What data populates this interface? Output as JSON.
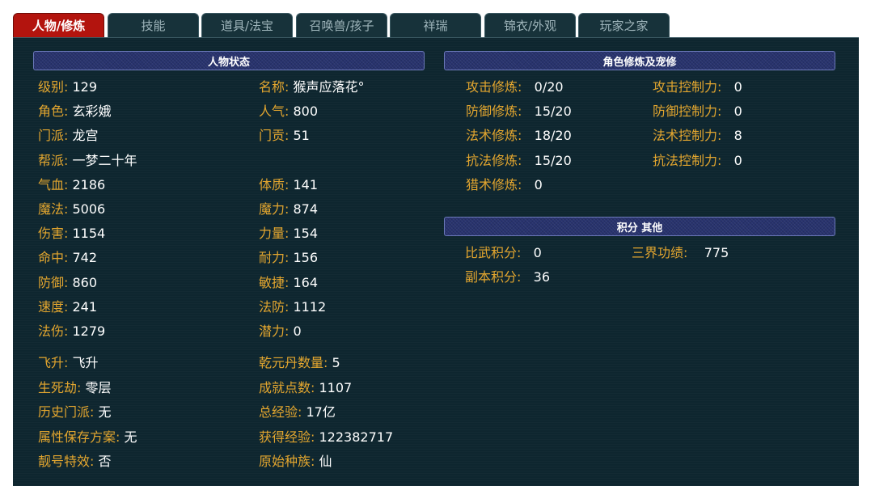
{
  "tabs": [
    "人物/修炼",
    "技能",
    "道具/法宝",
    "召唤兽/孩子",
    "祥瑞",
    "锦衣/外观",
    "玩家之家"
  ],
  "status_section": {
    "title": "人物状态",
    "left": [
      {
        "label": "级别:",
        "value": "129"
      },
      {
        "label": "角色:",
        "value": "玄彩娥"
      },
      {
        "label": "门派:",
        "value": "龙宫"
      },
      {
        "label": "帮派:",
        "value": "一梦二十年"
      },
      {
        "label": "气血:",
        "value": "2186"
      },
      {
        "label": "魔法:",
        "value": "5006"
      },
      {
        "label": "伤害:",
        "value": "1154"
      },
      {
        "label": "命中:",
        "value": "742"
      },
      {
        "label": "防御:",
        "value": "860"
      },
      {
        "label": "速度:",
        "value": "241"
      },
      {
        "label": "法伤:",
        "value": "1279"
      },
      {
        "label": "飞升:",
        "value": "飞升"
      },
      {
        "label": "生死劫:",
        "value": "零层"
      },
      {
        "label": "历史门派:",
        "value": "无"
      },
      {
        "label": "属性保存方案:",
        "value": "无"
      },
      {
        "label": "靓号特效:",
        "value": "否"
      }
    ],
    "right": [
      {
        "label": "名称:",
        "value": "猴声应落花°"
      },
      {
        "label": "人气:",
        "value": "800"
      },
      {
        "label": "门贡:",
        "value": "51"
      },
      {
        "label": "体质:",
        "value": "141"
      },
      {
        "label": "魔力:",
        "value": "874"
      },
      {
        "label": "力量:",
        "value": "154"
      },
      {
        "label": "耐力:",
        "value": "156"
      },
      {
        "label": "敏捷:",
        "value": "164"
      },
      {
        "label": "法防:",
        "value": "1112"
      },
      {
        "label": "潜力:",
        "value": "0"
      },
      {
        "label": "乾元丹数量:",
        "value": "5"
      },
      {
        "label": "成就点数:",
        "value": "1107"
      },
      {
        "label": "总经验:",
        "value": "17亿"
      },
      {
        "label": "获得经验:",
        "value": "122382717"
      },
      {
        "label": "原始种族:",
        "value": "仙"
      }
    ]
  },
  "cultivation_section": {
    "title": "角色修炼及宠修",
    "left": [
      {
        "label": "攻击修炼:",
        "value": "0/20"
      },
      {
        "label": "防御修炼:",
        "value": "15/20"
      },
      {
        "label": "法术修炼:",
        "value": "18/20"
      },
      {
        "label": "抗法修炼:",
        "value": "15/20"
      },
      {
        "label": "猎术修炼:",
        "value": "0"
      }
    ],
    "right": [
      {
        "label": "攻击控制力:",
        "value": "0"
      },
      {
        "label": "防御控制力:",
        "value": "0"
      },
      {
        "label": "法术控制力:",
        "value": "8"
      },
      {
        "label": "抗法控制力:",
        "value": "0"
      }
    ]
  },
  "points_section": {
    "title": "积分 其他",
    "items": [
      {
        "label": "比武积分:",
        "value": "0"
      },
      {
        "label": "三界功绩:",
        "value": "775"
      },
      {
        "label": "副本积分:",
        "value": "36"
      }
    ]
  }
}
